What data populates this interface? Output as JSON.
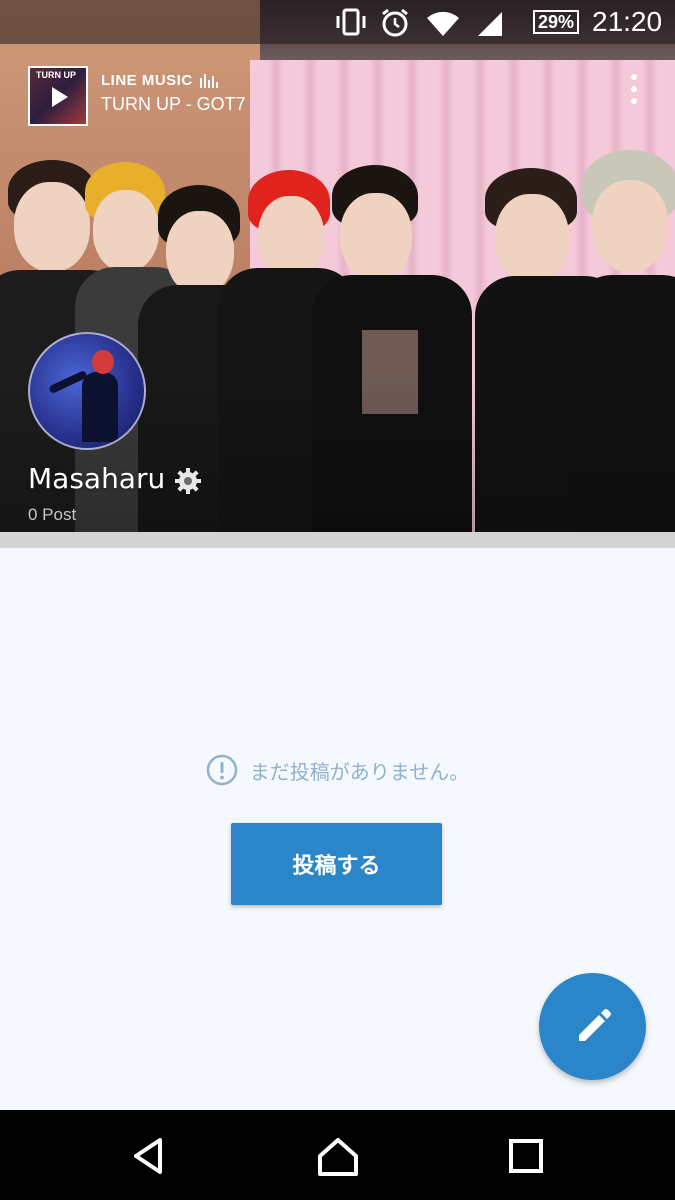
{
  "status_bar": {
    "battery": "29%",
    "time": "21:20",
    "icons": [
      "vibrate-icon",
      "alarm-icon",
      "wifi-icon",
      "signal-icon",
      "battery-icon"
    ]
  },
  "music_widget": {
    "album_art_text": "TURN UP",
    "service": "LINE MUSIC",
    "track": "TURN UP - GOT7"
  },
  "profile": {
    "name": "Masaharu",
    "post_count": "0 Post"
  },
  "empty_state": {
    "message": "まだ投稿がありません。",
    "button_label": "投稿する"
  },
  "colors": {
    "accent": "#2a86c9",
    "background": "#f5f9fd",
    "empty_text": "#8fb3cc"
  },
  "navigation": [
    "back-icon",
    "home-icon",
    "recents-icon"
  ]
}
